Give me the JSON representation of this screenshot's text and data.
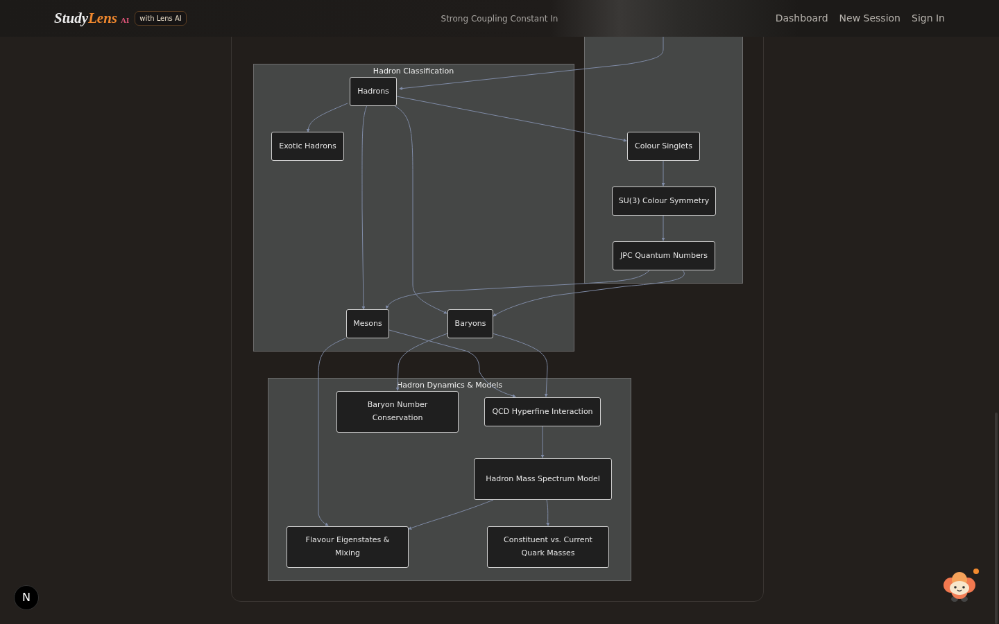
{
  "header": {
    "brand_primary": "Study",
    "brand_accent": "Lens",
    "brand_tag": "AI",
    "badge": "with Lens AI",
    "title": "Strong Coupling Constant In",
    "nav": [
      "Dashboard",
      "New Session",
      "Sign In"
    ]
  },
  "diagram": {
    "subgraphs": [
      {
        "title": "Hadron Classification",
        "nodes": [
          "Hadrons",
          "Exotic Hadrons",
          "Mesons",
          "Baryons"
        ]
      },
      {
        "nodes": [
          "Colour Singlets",
          "SU(3) Colour Symmetry",
          "JPC Quantum Numbers"
        ]
      },
      {
        "title": "Hadron Dynamics & Models",
        "nodes": [
          "Baryon Number Conservation",
          "QCD Hyperfine Interaction",
          "Hadron Mass Spectrum Model",
          "Flavour Eigenstates & Mixing",
          "Constituent vs. Current Quark Masses"
        ]
      }
    ]
  },
  "dev_badge": "N"
}
